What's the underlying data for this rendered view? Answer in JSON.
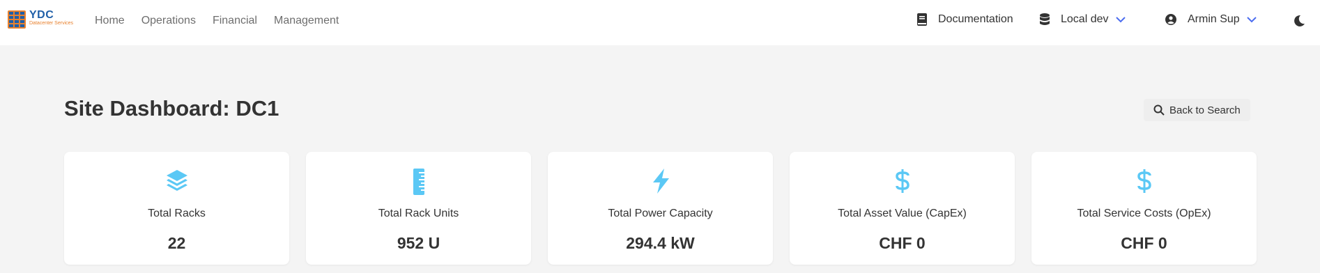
{
  "brand": {
    "title": "YDC",
    "subtitle": "Datacenter Services"
  },
  "nav": {
    "links": [
      "Home",
      "Operations",
      "Financial",
      "Management"
    ],
    "documentation": "Documentation",
    "environment": "Local dev",
    "user": "Armin Sup"
  },
  "page": {
    "title": "Site Dashboard: DC1",
    "back_button": "Back to Search"
  },
  "cards": [
    {
      "icon": "layers-icon",
      "label": "Total Racks",
      "value": "22"
    },
    {
      "icon": "ruler-icon",
      "label": "Total Rack Units",
      "value": "952 U"
    },
    {
      "icon": "bolt-icon",
      "label": "Total Power Capacity",
      "value": "294.4 kW"
    },
    {
      "icon": "dollar-icon",
      "label": "Total Asset Value (CapEx)",
      "value": "CHF 0"
    },
    {
      "icon": "dollar-icon",
      "label": "Total Service Costs (OpEx)",
      "value": "CHF 0"
    }
  ],
  "colors": {
    "accent": "#4b6cf0",
    "card_icon": "#5bc8f5",
    "logo_blue": "#1f5fa8",
    "logo_orange": "#e8812e"
  }
}
